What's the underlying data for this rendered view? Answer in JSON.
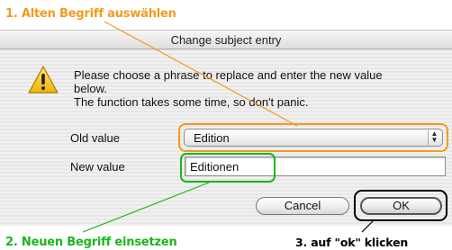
{
  "annotations": {
    "step1": "1. Alten Begriff auswählen",
    "step2": "2. Neuen Begriff einsetzen",
    "step3": "3. auf \"ok\" klicken"
  },
  "dialog": {
    "title": "Change subject entry",
    "title_clip": "...",
    "message_lines": [
      "Please choose a phrase to replace and enter the new value",
      "below.",
      "The function takes some time, so don't panic."
    ],
    "old_value_label": "Old value",
    "old_value_selected": "Edition",
    "new_value_label": "New value",
    "new_value_text": "Editionen",
    "cancel_label": "Cancel",
    "ok_label": "OK"
  },
  "colors": {
    "step1": "#f39a1e",
    "step2": "#19b619",
    "step3": "#000000"
  },
  "icons": {
    "alert": "warning-triangle-icon",
    "select_arrows": "up-down-arrows-icon"
  }
}
